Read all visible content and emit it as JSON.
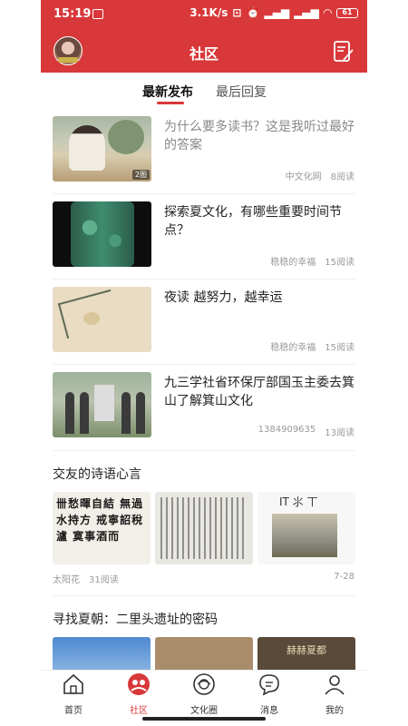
{
  "status_bar": {
    "time": "15:19",
    "network_speed": "3.1K/s",
    "battery": "61"
  },
  "header": {
    "title": "社区"
  },
  "tabs": [
    {
      "label": "最新发布",
      "active": true
    },
    {
      "label": "最后回复",
      "active": false
    }
  ],
  "articles": [
    {
      "title": "为什么要多读书？这是我听过最好的答案",
      "author": "中文化网",
      "reads": "8阅读",
      "badge": "2图",
      "visited": true
    },
    {
      "title": "探索夏文化，有哪些重要时间节点？",
      "author": "稳稳的幸福",
      "reads": "15阅读",
      "visited": false
    },
    {
      "title": "夜读  越努力，越幸运",
      "author": "稳稳的幸福",
      "reads": "15阅读",
      "visited": false
    },
    {
      "title": "九三学社省环保厅部国玉主委去箕山了解箕山文化",
      "author": "1384909635",
      "reads": "13阅读",
      "visited": false
    }
  ],
  "poem_post": {
    "title": "交友的诗语心言",
    "calligraphy_text": "卌愁暉自結 無過水持方 戒寧詔稅瀘 寞事酒而",
    "thumb3_text": "IT ⺢ 丅",
    "author": "太阳花",
    "reads": "31阅读",
    "date": "7-28"
  },
  "xia_post": {
    "title": "寻找夏朝：二里头遗址的密码",
    "thumb3_text": "赫赫夏都"
  },
  "bottom_nav": [
    {
      "label": "首页",
      "icon": "home-icon",
      "active": false
    },
    {
      "label": "社区",
      "icon": "community-icon",
      "active": true
    },
    {
      "label": "文化圈",
      "icon": "culture-circle-icon",
      "active": false
    },
    {
      "label": "消息",
      "icon": "message-icon",
      "active": false
    },
    {
      "label": "我的",
      "icon": "profile-icon",
      "active": false
    }
  ],
  "colors": {
    "brand": "#d9383a",
    "text": "#222222",
    "muted": "#999999"
  }
}
